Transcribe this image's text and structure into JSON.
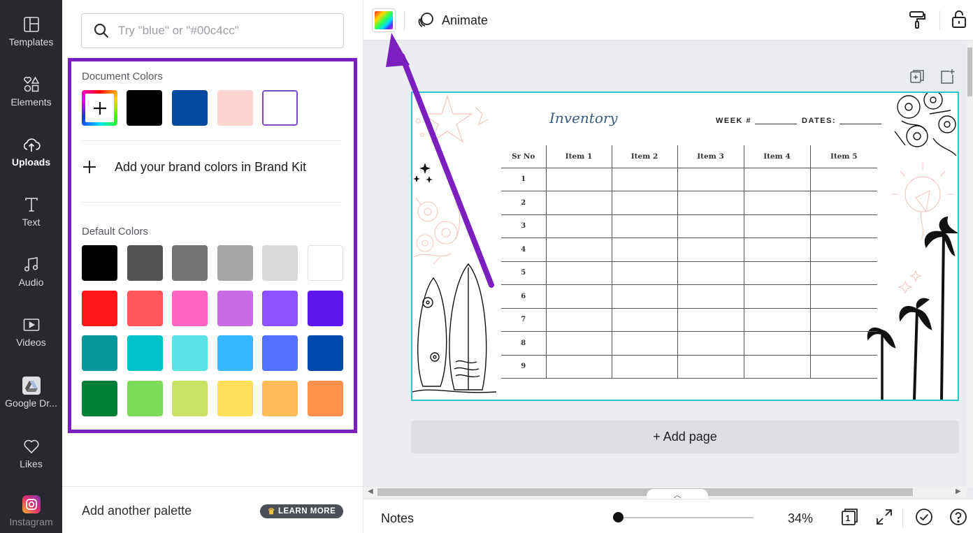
{
  "sidebar": {
    "items": [
      {
        "label": "Templates",
        "icon": "templates-icon"
      },
      {
        "label": "Elements",
        "icon": "elements-icon"
      },
      {
        "label": "Uploads",
        "icon": "uploads-icon"
      },
      {
        "label": "Text",
        "icon": "text-icon"
      },
      {
        "label": "Audio",
        "icon": "audio-icon"
      },
      {
        "label": "Videos",
        "icon": "videos-icon"
      },
      {
        "label": "Google Dr...",
        "icon": "google-drive-icon"
      },
      {
        "label": "Likes",
        "icon": "heart-icon"
      },
      {
        "label": "Instagram",
        "icon": "instagram-icon"
      }
    ],
    "active": "Uploads"
  },
  "color_panel": {
    "search_placeholder": "Try \"blue\" or \"#00c4cc\"",
    "document_colors_title": "Document Colors",
    "document_colors": [
      "add",
      "#000000",
      "#014aa0",
      "#fdd5d0",
      "#ffffff"
    ],
    "brand_kit_text": "Add your brand colors in Brand Kit",
    "default_colors_title": "Default Colors",
    "default_colors": [
      [
        "#000000",
        "#545454",
        "#737373",
        "#a6a6a6",
        "#d9d9d9",
        "#ffffff"
      ],
      [
        "#ff1616",
        "#ff5757",
        "#ff66c4",
        "#cb6ce6",
        "#8c52ff",
        "#5e17eb"
      ],
      [
        "#03989e",
        "#00c2cb",
        "#5ce1e6",
        "#38b6ff",
        "#5271ff",
        "#004aad"
      ],
      [
        "#008037",
        "#7ed957",
        "#c9e265",
        "#ffde59",
        "#ffbd59",
        "#ff914d"
      ]
    ],
    "add_palette": "Add another palette",
    "learn_more": "LEARN MORE"
  },
  "toolbar": {
    "animate": "Animate"
  },
  "design": {
    "title": "Inventory",
    "week_label": "WEEK #",
    "dates_label": "DATES:",
    "columns": [
      "Sr No",
      "Item 1",
      "Item 2",
      "Item 3",
      "Item 4",
      "Item 5"
    ],
    "rows": [
      "1",
      "2",
      "3",
      "4",
      "5",
      "6",
      "7",
      "8",
      "9"
    ]
  },
  "add_page": "+ Add page",
  "bottom": {
    "notes": "Notes",
    "zoom": "34%",
    "zoom_fraction": 0.02,
    "page_count": "1"
  },
  "colors": {
    "highlight": "#7b1fbf",
    "canvas_border": "#2dc6ce",
    "sidebar_bg": "#27292f"
  }
}
